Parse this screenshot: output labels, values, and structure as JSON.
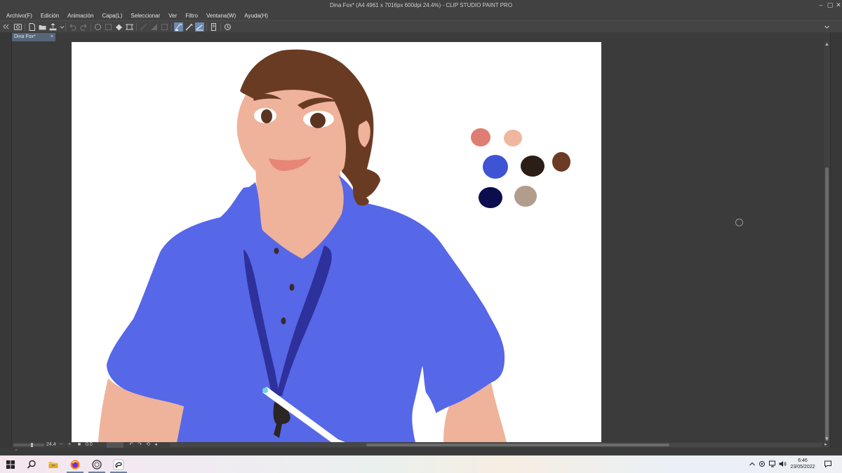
{
  "window": {
    "title": "Dina Fox* (A4 4961 x 7016px 600dpi 24.4%)  - CLIP STUDIO PAINT PRO",
    "controls": [
      "minimize-icon",
      "maximize-icon",
      "close-icon"
    ]
  },
  "menu": {
    "items": [
      {
        "label": "Archivo(F)"
      },
      {
        "label": "Edición"
      },
      {
        "label": "Animación"
      },
      {
        "label": "Capa(L)"
      },
      {
        "label": "Seleccionar"
      },
      {
        "label": "Ver"
      },
      {
        "label": "Filtro"
      },
      {
        "label": "Ventana(W)"
      },
      {
        "label": "Ayuda(H)"
      }
    ]
  },
  "toolbar": {
    "icons": [
      "clip-studio-icon",
      "new-file-icon",
      "open-file-icon",
      "save-icon",
      "undo-icon",
      "redo-icon",
      "clear-icon",
      "fill-icon",
      "transform-icon",
      "crop-icon",
      "invert-selection-icon",
      "layer-icon",
      "snap-ruler-icon",
      "snap-special-icon",
      "snap-grid-icon",
      "page-icon",
      "refresh-icon"
    ],
    "active_icons": [
      "snap-ruler-icon",
      "snap-special-icon",
      "snap-grid-icon"
    ]
  },
  "tabs": [
    {
      "label": "Dina Fox*",
      "close_label": "×"
    }
  ],
  "status": {
    "zoom_value": "24.4",
    "rotation_value": "0.0",
    "zoom_minus": "−",
    "zoom_plus": "+"
  },
  "canvas": {
    "background": "#ffffff",
    "palette_swatches": [
      "#e07d72",
      "#f0b7a0",
      "#3e54d4",
      "#2a1e16",
      "#6b3b25",
      "#0b0d4d",
      "#b29d8c"
    ],
    "colors": {
      "shirt": "#5667e8",
      "skin": "#efb29a",
      "hair": "#6a3b23",
      "lanyard": "#2e309c",
      "lips": "#e78577",
      "eyes": "#5a3420",
      "buttons": "#3a2b2b",
      "badge_clip": "#2b2523",
      "pen_body": "#ffffff",
      "pen_tip": "#6cd1ee"
    }
  },
  "taskbar": {
    "apps": [
      "windows-start-icon",
      "search-icon",
      "file-explorer-icon",
      "firefox-icon",
      "clip-studio-icon",
      "clip-studio-paint-icon"
    ],
    "tray": [
      "chevron-up-icon",
      "network-icon",
      "display-icon",
      "volume-icon"
    ],
    "time": "6:46",
    "date": "23/05/2022"
  }
}
